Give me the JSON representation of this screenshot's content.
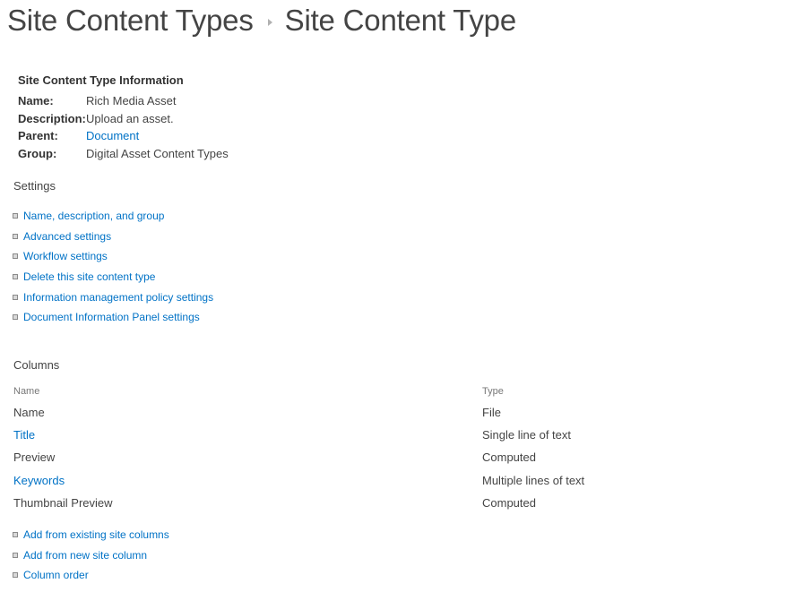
{
  "breadcrumb": {
    "parent": "Site Content Types",
    "current": "Site Content Type"
  },
  "info": {
    "heading": "Site Content Type Information",
    "rows": [
      {
        "label": "Name:",
        "value": "Rich Media Asset",
        "is_link": false
      },
      {
        "label": "Description:",
        "value": "Upload an asset.",
        "is_link": false
      },
      {
        "label": "Parent:",
        "value": "Document",
        "is_link": true
      },
      {
        "label": "Group:",
        "value": "Digital Asset Content Types",
        "is_link": false
      }
    ]
  },
  "settings": {
    "heading": "Settings",
    "links": [
      "Name, description, and group",
      "Advanced settings",
      "Workflow settings",
      "Delete this site content type",
      "Information management policy settings",
      "Document Information Panel settings"
    ]
  },
  "columns": {
    "heading": "Columns",
    "headers": {
      "name": "Name",
      "type": "Type"
    },
    "rows": [
      {
        "name": "Name",
        "type": "File",
        "is_link": false
      },
      {
        "name": "Title",
        "type": "Single line of text",
        "is_link": true
      },
      {
        "name": "Preview",
        "type": "Computed",
        "is_link": false
      },
      {
        "name": "Keywords",
        "type": "Multiple lines of text",
        "is_link": true
      },
      {
        "name": "Thumbnail Preview",
        "type": "Computed",
        "is_link": false
      }
    ],
    "actions": [
      "Add from existing site columns",
      "Add from new site column",
      "Column order"
    ]
  },
  "colors": {
    "link": "#0072c6",
    "text": "#444444",
    "muted": "#777777"
  }
}
